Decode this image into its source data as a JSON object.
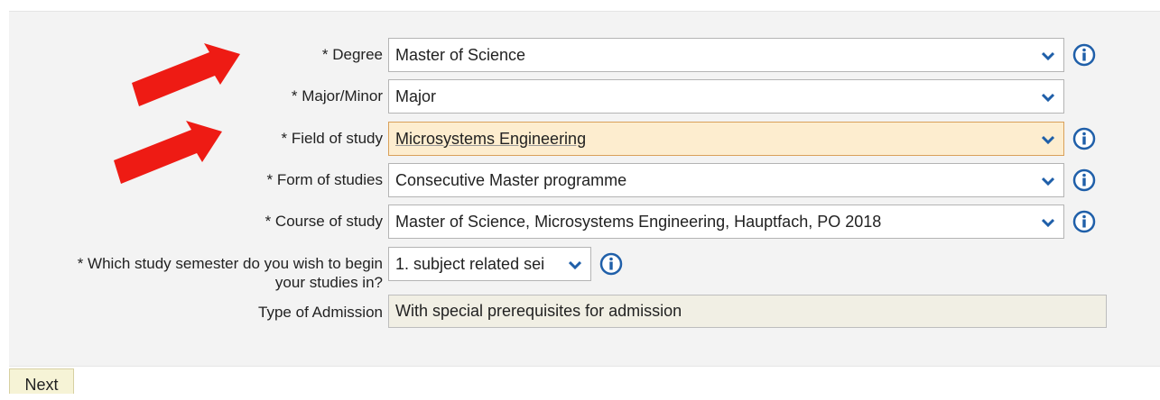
{
  "fields": {
    "degree": {
      "label": "* Degree",
      "value": "Master of Science"
    },
    "major_minor": {
      "label": "* Major/Minor",
      "value": "Major"
    },
    "field_of_study": {
      "label": "* Field of study",
      "value": "Microsystems Engineering"
    },
    "form_of_studies": {
      "label": "* Form of studies",
      "value": "Consecutive Master programme"
    },
    "course_of_study": {
      "label": "* Course of study",
      "value": "Master of Science, Microsystems Engineering, Hauptfach, PO 2018"
    },
    "study_semester": {
      "label": "* Which study semester do you wish to begin your studies in?",
      "value": "1. subject related sei"
    },
    "type_of_admission": {
      "label": "Type of Admission",
      "value": "With special prerequisites for admission"
    }
  },
  "footer": {
    "next_label": "Next"
  },
  "colors": {
    "accent_blue": "#1f5fa9",
    "arrow_red": "#ee1b14",
    "focused_bg": "#fdedcf",
    "readonly_bg": "#f1efe4",
    "panel_bg": "#f3f3f3"
  },
  "icons": {
    "dropdown": "chevron-down-icon",
    "info": "info-icon",
    "annotation": "red-arrow-annotation"
  }
}
